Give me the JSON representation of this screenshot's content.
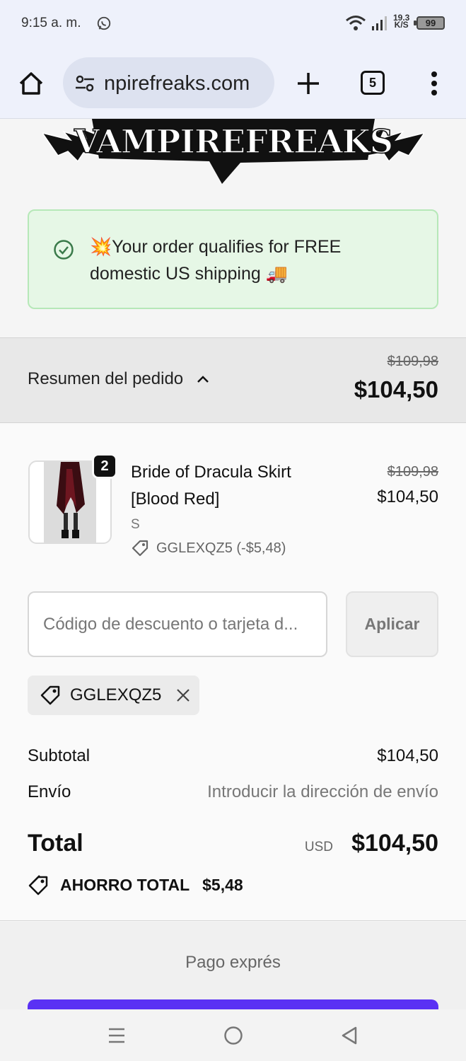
{
  "status_bar": {
    "time": "9:15 a. m.",
    "speed_top": "19.3",
    "speed_bottom": "K/S",
    "battery": "99"
  },
  "browser": {
    "url": "npirefreaks.com",
    "tab_count": "5"
  },
  "logo": {
    "text": "VAMPIREFREAKS"
  },
  "banner": {
    "text": "💥Your order qualifies for FREE domestic US shipping 🚚"
  },
  "summary": {
    "toggle_label": "Resumen del pedido",
    "old_total": "$109,98",
    "total": "$104,50"
  },
  "item": {
    "quantity": "2",
    "name": "Bride of Dracula Skirt [Blood Red]",
    "old_price": "$109,98",
    "price": "$104,50",
    "variant": "S",
    "discount": "GGLEXQZ5 (-$5,48)"
  },
  "discount_form": {
    "placeholder": "Código de descuento o tarjeta d...",
    "apply_label": "Aplicar",
    "applied_code": "GGLEXQZ5"
  },
  "totals": {
    "subtotal_label": "Subtotal",
    "subtotal_value": "$104,50",
    "shipping_label": "Envío",
    "shipping_value": "Introducir la dirección de envío",
    "total_label": "Total",
    "currency": "USD",
    "total_value": "$104,50",
    "savings_label": "AHORRO TOTAL",
    "savings_value": "$5,48"
  },
  "express": {
    "label": "Pago exprés"
  },
  "colors": {
    "accent": "#5a31f4",
    "banner_bg": "#e6f7e6",
    "banner_border": "#b6e8b8"
  }
}
